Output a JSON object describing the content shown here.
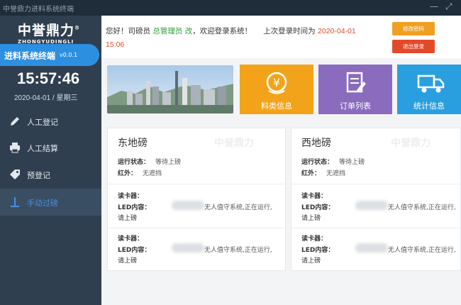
{
  "window": {
    "title": "中誉鼎力进料系统终端"
  },
  "sidebar": {
    "logo_cn": "中誉鼎力",
    "logo_en": "ZHONGYUDINGLI",
    "app_name": "进料系统终端",
    "version": "v0.0.1",
    "clock": "15:57:46",
    "date": "2020-04-01",
    "weekday": "星期三",
    "date_sep": " / ",
    "items": [
      {
        "label": "人工登记",
        "icon": "pencil-icon"
      },
      {
        "label": "人工结算",
        "icon": "printer-icon"
      },
      {
        "label": "预登记",
        "icon": "tag-icon"
      },
      {
        "label": "手动过磅",
        "icon": "scale-icon"
      }
    ]
  },
  "header": {
    "greet_prefix": "您好！司磅员",
    "role": "总管理员",
    "user": "改",
    "welcome": "，欢迎登录系统！",
    "last_login_label": "上次登录时间为",
    "last_login_date": "2020-04-01",
    "last_login_time": "15:06",
    "change_pwd": "修改密码",
    "logout": "退出登录"
  },
  "tiles": [
    {
      "label": "料类信息",
      "icon": "yen-coin-icon",
      "color": "#f3a31a"
    },
    {
      "label": "订单列表",
      "icon": "order-list-icon",
      "color": "#8a6bbd"
    },
    {
      "label": "统计信息",
      "icon": "truck-icon",
      "color": "#2a9fe0"
    }
  ],
  "watermark": "中誉鼎力",
  "cards": [
    {
      "title": "东地磅",
      "status_label": "运行状态：",
      "status": "等待上磅",
      "ir_label": "红外：",
      "ir": "无遮挡",
      "reader_label": "读卡器：",
      "led_label": "LED内容：",
      "led_text_1": "无人值守系统,正在运行,",
      "led_text_2": "请上磅"
    },
    {
      "title": "西地磅",
      "status_label": "运行状态：",
      "status": "等待上磅",
      "ir_label": "红外：",
      "ir": "无遮挡",
      "reader_label": "读卡器：",
      "led_label": "LED内容：",
      "led_text_1": "无人值守系统,正在运行,",
      "led_text_2": "请上磅"
    }
  ]
}
